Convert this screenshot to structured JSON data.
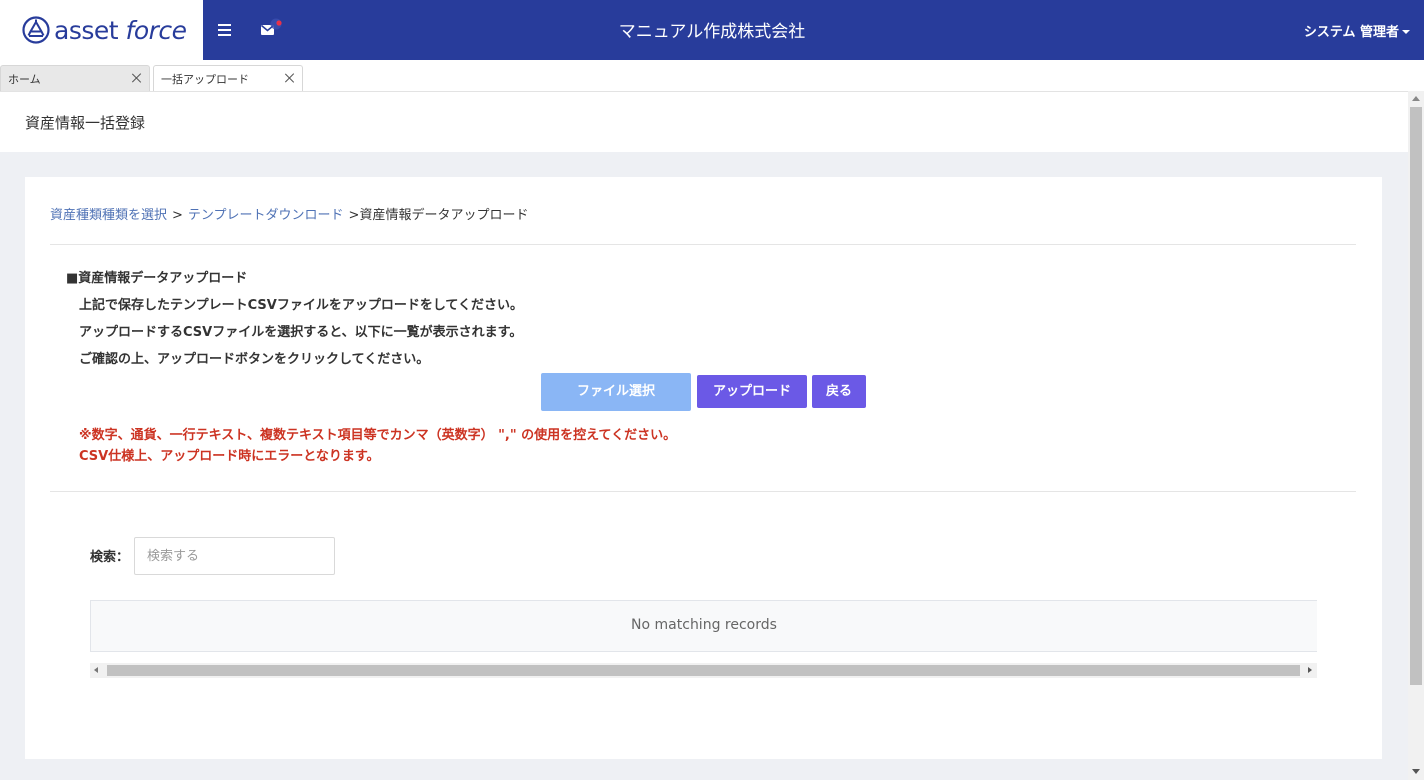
{
  "header": {
    "logo_asset": "asset",
    "logo_force": "force",
    "company_name": "マニュアル作成株式会社",
    "user_name": "システム 管理者",
    "brand_color": "#283c9b",
    "notification_dot_color": "#e8324a"
  },
  "tabs": [
    {
      "label": "ホーム"
    },
    {
      "label": "一括アップロード"
    }
  ],
  "page": {
    "title": "資産情報一括登録"
  },
  "breadcrumb": {
    "step1": "資産種類種類を選択",
    "sep1": ">",
    "step2": "テンプレートダウンロード",
    "sep2": ">",
    "current": "資産情報データアップロード"
  },
  "upload_section": {
    "title": "■資産情報データアップロード",
    "instruction_1": "上記で保存したテンプレートCSVファイルをアップロードをしてください。",
    "instruction_2": "アップロードするCSVファイルを選択すると、以下に一覧が表示されます。",
    "instruction_3": "ご確認の上、アップロードボタンをクリックしてください。",
    "file_select_label": "ファイル選択",
    "upload_label": "アップロード",
    "back_label": "戻る",
    "warning_1": "※数字、通貨、一行テキスト、複数テキスト項目等でカンマ（英数字） \",\"  の使用を控えてください。",
    "warning_2": "CSV仕様上、アップロード時にエラーとなります。",
    "warning_color": "#cc3322"
  },
  "search": {
    "label": "検索：",
    "placeholder": "検索する",
    "value": ""
  },
  "table": {
    "empty_message": "No matching records"
  }
}
